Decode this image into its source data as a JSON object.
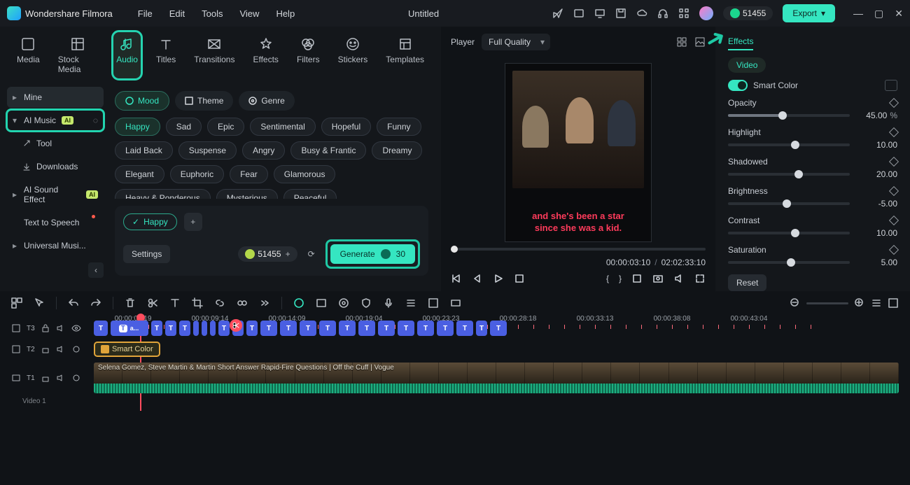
{
  "app": {
    "name": "Wondershare Filmora",
    "document": "Untitled"
  },
  "menu": [
    "File",
    "Edit",
    "Tools",
    "View",
    "Help"
  ],
  "header": {
    "credits": "51455",
    "export": "Export"
  },
  "mediaTabs": [
    "Media",
    "Stock Media",
    "Audio",
    "Titles",
    "Transitions",
    "Effects",
    "Filters",
    "Stickers",
    "Templates"
  ],
  "sidebar": {
    "mine": "Mine",
    "aimusic": "AI Music",
    "tool": "Tool",
    "downloads": "Downloads",
    "aisound": "AI Sound Effect",
    "tts": "Text to Speech",
    "universal": "Universal Musi..."
  },
  "filters": {
    "mood": "Mood",
    "theme": "Theme",
    "genre": "Genre"
  },
  "moods": [
    "Happy",
    "Sad",
    "Epic",
    "Sentimental",
    "Hopeful",
    "Funny",
    "Laid Back",
    "Suspense",
    "Angry",
    "Busy & Frantic",
    "Dreamy",
    "Elegant",
    "Euphoric",
    "Fear",
    "Glamorous",
    "Heavy & Ponderous",
    "Mysterious",
    "Peaceful"
  ],
  "selectedMood": "Happy",
  "genPanel": {
    "tag": "Happy",
    "settings": "Settings",
    "credits": "51455",
    "generate": "Generate",
    "cost": "30"
  },
  "player": {
    "label": "Player",
    "quality": "Full Quality",
    "captionL1": "and she's been a star",
    "captionL2": "since she was a kid.",
    "current": "00:00:03:10",
    "total": "02:02:33:10"
  },
  "effects": {
    "tab": "Effects",
    "video": "Video",
    "smartColor": "Smart Color",
    "opacity": {
      "label": "Opacity",
      "value": "45.00",
      "unit": "%",
      "pos": 45
    },
    "highlight": {
      "label": "Highlight",
      "value": "10.00",
      "pos": 55
    },
    "shadowed": {
      "label": "Shadowed",
      "value": "20.00",
      "pos": 58
    },
    "brightness": {
      "label": "Brightness",
      "value": "-5.00",
      "pos": 48
    },
    "contrast": {
      "label": "Contrast",
      "value": "10.00",
      "pos": 55
    },
    "saturation": {
      "label": "Saturation",
      "value": "5.00",
      "pos": 52
    },
    "reset": "Reset"
  },
  "timeline": {
    "ruler": [
      "00:00:04:19",
      "00:00:09:14",
      "00:00:14:09",
      "00:00:19:04",
      "00:00:23:23",
      "00:00:28:18",
      "00:00:33:13",
      "00:00:38:08",
      "00:00:43:04"
    ],
    "textBadge": "T",
    "textFirst": "T a...",
    "effectClip": "Smart Color",
    "videoClipLabel": "Selena Gomez, Steve Martin & Martin Short Answer Rapid-Fire Questions | Off the Cuff | Vogue",
    "trackLabel": "Video 1",
    "tracks": [
      "T3",
      "T2",
      "T1"
    ]
  }
}
